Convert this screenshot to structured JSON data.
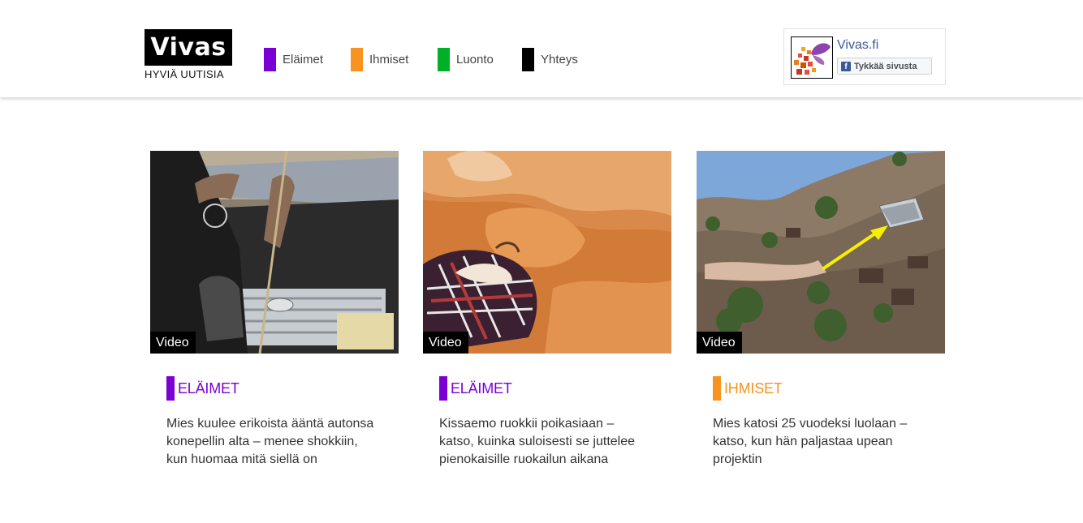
{
  "header": {
    "logo_text": "Vivas",
    "logo_tagline": "HYVIÄ UUTISIA",
    "nav": [
      {
        "label": "Eläimet",
        "color": "#7b00d4"
      },
      {
        "label": "Ihmiset",
        "color": "#f7931e"
      },
      {
        "label": "Luonto",
        "color": "#00b027"
      },
      {
        "label": "Yhteys",
        "color": "#000000"
      }
    ],
    "facebook": {
      "page_name": "Vivas.fi",
      "like_label": "Tykkää sivusta",
      "icon": "facebook-f-icon"
    }
  },
  "cards": [
    {
      "badge": "Video",
      "category": "ELÄIMET",
      "category_color": "#7b00d4",
      "title": "Mies kuulee erikoista ääntä autonsa konepellin alta – menee shokkiin, kun huomaa mitä siellä on"
    },
    {
      "badge": "Video",
      "category": "ELÄIMET",
      "category_color": "#7b00d4",
      "title": "Kissaemo ruokkii poikasiaan – katso, kuinka suloisesti se juttelee pienokaisille ruokailun aikana"
    },
    {
      "badge": "Video",
      "category": "IHMISET",
      "category_color": "#f7931e",
      "title": "Mies katosi 25 vuodeksi luolaan – katso, kun hän paljastaa upean projektin"
    }
  ]
}
